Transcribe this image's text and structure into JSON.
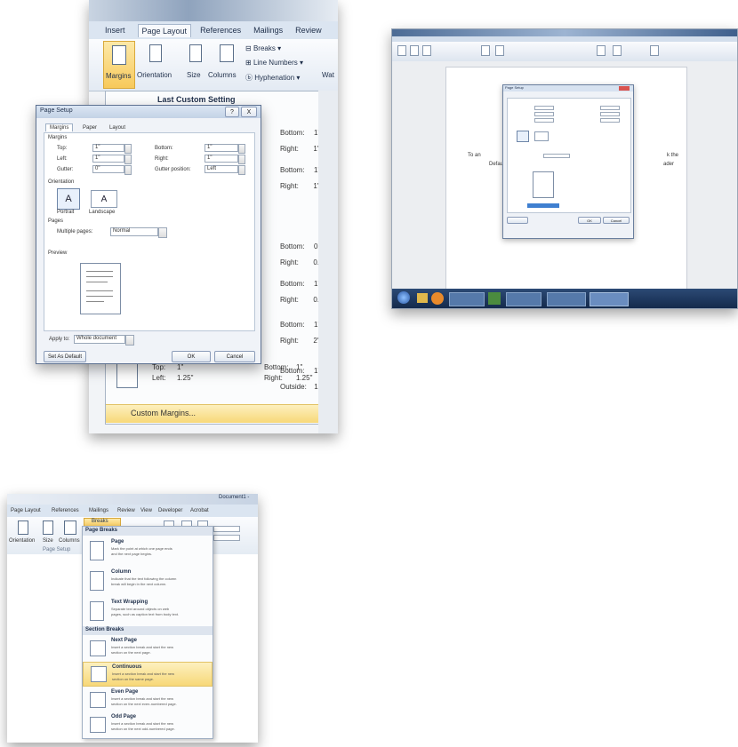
{
  "panel1": {
    "ribbon_tabs": [
      "Insert",
      "Page Layout",
      "References",
      "Mailings",
      "Review"
    ],
    "ribbon_buttons": {
      "margins": "Margins",
      "orientation": "Orientation",
      "size": "Size",
      "columns": "Columns",
      "breaks": "Breaks",
      "line_numbers": "Line Numbers",
      "hyphenation": "Hyphenation",
      "watermark": "Wat"
    },
    "margins_menu": {
      "last_custom": "Last Custom Setting",
      "presets": [
        {
          "label": "Bottom:",
          "value": "1\"",
          "label2": "Right:",
          "value2": "1\""
        },
        {
          "label": "Bottom:",
          "value": "1\"",
          "label2": "Right:",
          "value2": "1\""
        },
        {
          "label": "Bottom:",
          "value": "0.5\"",
          "label2": "Right:",
          "value2": "0.5\""
        },
        {
          "label": "Bottom:",
          "value": "1\"",
          "label2": "Right:",
          "value2": "0.75\""
        },
        {
          "label": "Bottom:",
          "value": "1\"",
          "label2": "Right:",
          "value2": "2\""
        },
        {
          "label": "Bottom:",
          "value": "1\"",
          "label2": "Outside:",
          "value2": "1\""
        }
      ],
      "last_preset": {
        "top_label": "Top:",
        "top": "1\"",
        "left_label": "Left:",
        "left": "1.25\"",
        "bottom_label": "Bottom:",
        "bottom": "1\"",
        "right_label": "Right:",
        "right": "1.25\""
      },
      "custom_margins": "Custom Margins..."
    },
    "dialog": {
      "title": "Page Setup",
      "help": "?",
      "close": "X",
      "tabs": [
        "Margins",
        "Paper",
        "Layout"
      ],
      "section_margins": "Margins",
      "top_label": "Top:",
      "top_value": "1\"",
      "bottom_label": "Bottom:",
      "bottom_value": "1\"",
      "left_label": "Left:",
      "left_value": "1\"",
      "right_label": "Right:",
      "right_value": "1\"",
      "gutter_label": "Gutter:",
      "gutter_value": "0\"",
      "gutter_pos_label": "Gutter position:",
      "gutter_pos_value": "Left",
      "section_orientation": "Orientation",
      "portrait": "Portrait",
      "landscape": "Landscape",
      "section_pages": "Pages",
      "multiple_pages_label": "Multiple pages:",
      "multiple_pages_value": "Normal",
      "section_preview": "Preview",
      "apply_to_label": "Apply to:",
      "apply_to_value": "Whole document",
      "set_default": "Set As Default",
      "ok": "OK",
      "cancel": "Cancel"
    }
  },
  "panel2": {
    "doc_text_left": "To an",
    "doc_text_left2": "Defaul",
    "doc_text_right": "k the",
    "doc_text_right2": "ader",
    "dialog": {
      "title": "Page Setup",
      "ok": "OK",
      "cancel": "Cancel"
    }
  },
  "panel3": {
    "tabs": [
      "Page Layout",
      "References",
      "Mailings",
      "Review",
      "View",
      "Developer",
      "Acrobat"
    ],
    "window_title": "Document1 -",
    "ribbon": {
      "orientation": "Orientation",
      "size": "Size",
      "columns": "Columns",
      "breaks": "Breaks",
      "group_label": "Page Setup"
    },
    "menu": {
      "page_breaks_header": "Page Breaks",
      "section_breaks_header": "Section Breaks",
      "items": [
        {
          "title": "Page",
          "desc1": "Mark the point at which one page ends",
          "desc2": "and the next page begins."
        },
        {
          "title": "Column",
          "desc1": "Indicate that the text following the column",
          "desc2": "break will begin in the next column."
        },
        {
          "title": "Text Wrapping",
          "desc1": "Separate text around objects on web",
          "desc2": "pages, such as caption text from body text."
        },
        {
          "title": "Next Page",
          "desc1": "Insert a section break and start the new",
          "desc2": "section on the next page."
        },
        {
          "title": "Continuous",
          "desc1": "Insert a section break and start the new",
          "desc2": "section on the same page."
        },
        {
          "title": "Even Page",
          "desc1": "Insert a section break and start the new",
          "desc2": "section on the next even-numbered page."
        },
        {
          "title": "Odd Page",
          "desc1": "Insert a section break and start the new",
          "desc2": "section on the next odd-numbered page."
        }
      ]
    }
  }
}
